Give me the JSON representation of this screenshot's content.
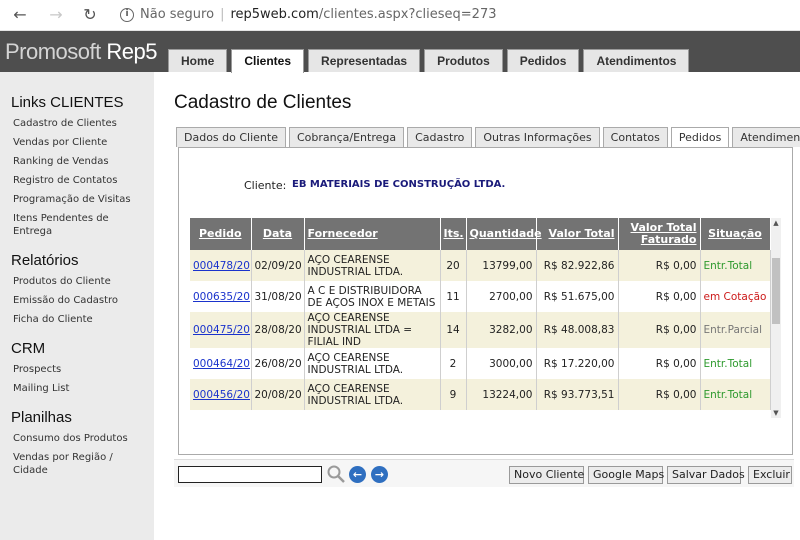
{
  "browser": {
    "security": "Não seguro",
    "host": "rep5web.com",
    "path": "/clientes.aspx?clieseq=273"
  },
  "app": {
    "logo_light": "Promosoft ",
    "logo_bold": "Rep5",
    "tabs": [
      "Home",
      "Clientes",
      "Representadas",
      "Produtos",
      "Pedidos",
      "Atendimentos"
    ],
    "active_tab": "Clientes"
  },
  "sidebar": {
    "sections": [
      {
        "title": "Links CLIENTES",
        "items": [
          "Cadastro de Clientes",
          "Vendas por Cliente",
          "Ranking de Vendas",
          "Registro de Contatos",
          "Programação de Visitas",
          "Itens Pendentes de Entrega"
        ]
      },
      {
        "title": "Relatórios",
        "items": [
          "Produtos do Cliente",
          "Emissão do Cadastro",
          "Ficha do Cliente"
        ]
      },
      {
        "title": "CRM",
        "items": [
          "Prospects",
          "Mailing List"
        ]
      },
      {
        "title": "Planilhas",
        "items": [
          "Consumo dos Produtos",
          "Vendas por Região / Cidade"
        ]
      }
    ]
  },
  "page": {
    "title": "Cadastro de Clientes",
    "subtabs": [
      "Dados do Cliente",
      "Cobrança/Entrega",
      "Cadastro",
      "Outras Informações",
      "Contatos",
      "Pedidos",
      "Atendimentos"
    ],
    "active_subtab": "Pedidos",
    "cliente_label": "Cliente:",
    "cliente_name": "EB MATERIAIS DE CONSTRUÇÃO LTDA."
  },
  "table": {
    "headers": [
      "Pedido",
      "Data",
      "Fornecedor",
      "Its.",
      "Quantidade",
      "Valor Total",
      "Valor Total Faturado",
      "Situação"
    ],
    "rows": [
      {
        "pedido": "000478/20",
        "data": "02/09/20",
        "fornecedor": "AÇO CEARENSE INDUSTRIAL LTDA.",
        "its": "20",
        "quantidade": "13799,00",
        "valor_total": "R$ 82.922,86",
        "valor_faturado": "R$ 0,00",
        "situacao": "Entr.Total",
        "status_color": "#2e9a2e"
      },
      {
        "pedido": "000635/20",
        "data": "31/08/20",
        "fornecedor": "A C E DISTRIBUIDORA DE AÇOS INOX E METAIS",
        "its": "11",
        "quantidade": "2700,00",
        "valor_total": "R$ 51.675,00",
        "valor_faturado": "R$ 0,00",
        "situacao": "em Cotação",
        "status_color": "#cc1a1a"
      },
      {
        "pedido": "000475/20",
        "data": "28/08/20",
        "fornecedor": "AÇO CEARENSE INDUSTRIAL LTDA = FILIAL IND",
        "its": "14",
        "quantidade": "3282,00",
        "valor_total": "R$ 48.008,83",
        "valor_faturado": "R$ 0,00",
        "situacao": "Entr.Parcial",
        "status_color": "#777777"
      },
      {
        "pedido": "000464/20",
        "data": "26/08/20",
        "fornecedor": "AÇO CEARENSE INDUSTRIAL LTDA.",
        "its": "2",
        "quantidade": "3000,00",
        "valor_total": "R$ 17.220,00",
        "valor_faturado": "R$ 0,00",
        "situacao": "Entr.Total",
        "status_color": "#2e9a2e"
      },
      {
        "pedido": "000456/20",
        "data": "20/08/20",
        "fornecedor": "AÇO CEARENSE INDUSTRIAL LTDA.",
        "its": "9",
        "quantidade": "13224,00",
        "valor_total": "R$ 93.773,51",
        "valor_faturado": "R$ 0,00",
        "situacao": "Entr.Total",
        "status_color": "#2e9a2e"
      }
    ]
  },
  "toolbar": {
    "search_value": "",
    "buttons": [
      "Novo Cliente",
      "Google Maps",
      "Salvar Dados",
      "Excluir"
    ]
  }
}
